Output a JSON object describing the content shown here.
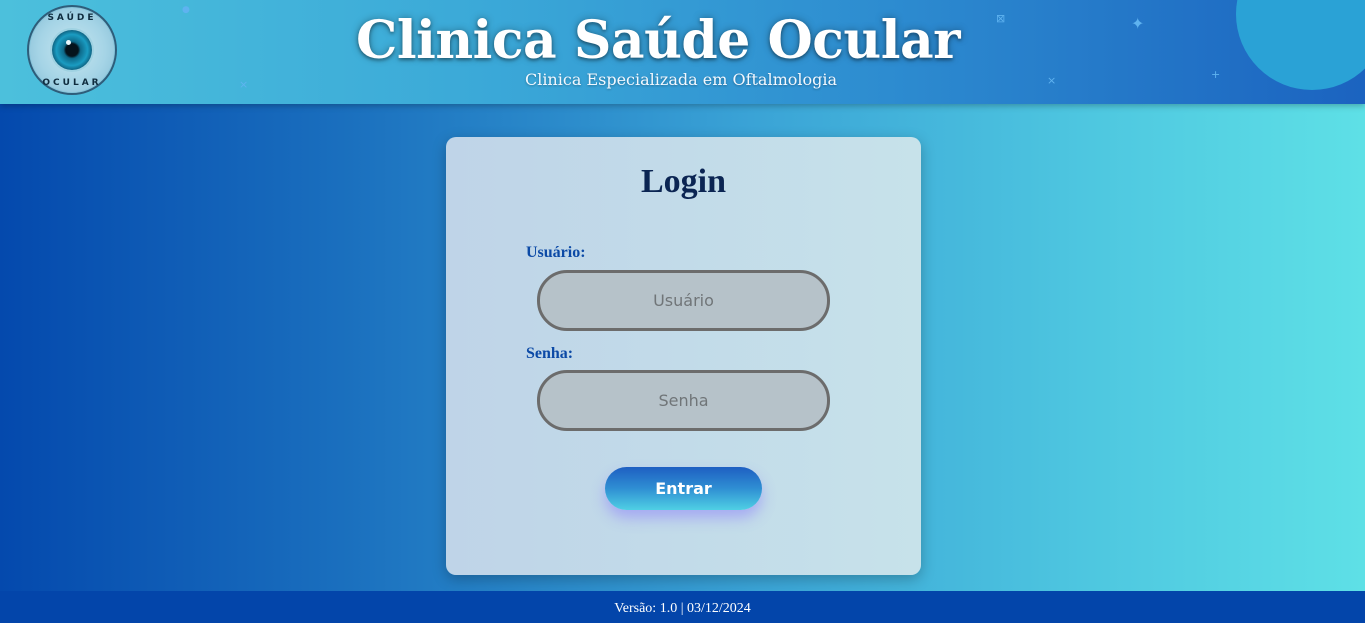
{
  "header": {
    "logo": {
      "text_top": "SAÚDE",
      "text_bottom": "OCULAR",
      "icon": "eye-icon"
    },
    "title": "Clinica Saúde Ocular",
    "subtitle": "Clinica Especializada em Oftalmologia"
  },
  "login": {
    "title": "Login",
    "username_label": "Usuário:",
    "username_placeholder": "Usuário",
    "username_value": "",
    "password_label": "Senha:",
    "password_placeholder": "Senha",
    "password_value": "",
    "submit_label": "Entrar"
  },
  "footer": {
    "version_text": "Versão: 1.0 | 03/12/2024"
  },
  "colors": {
    "accent": "#0345aa",
    "title_text": "#0b2553",
    "label_text": "#0c4aa6"
  }
}
